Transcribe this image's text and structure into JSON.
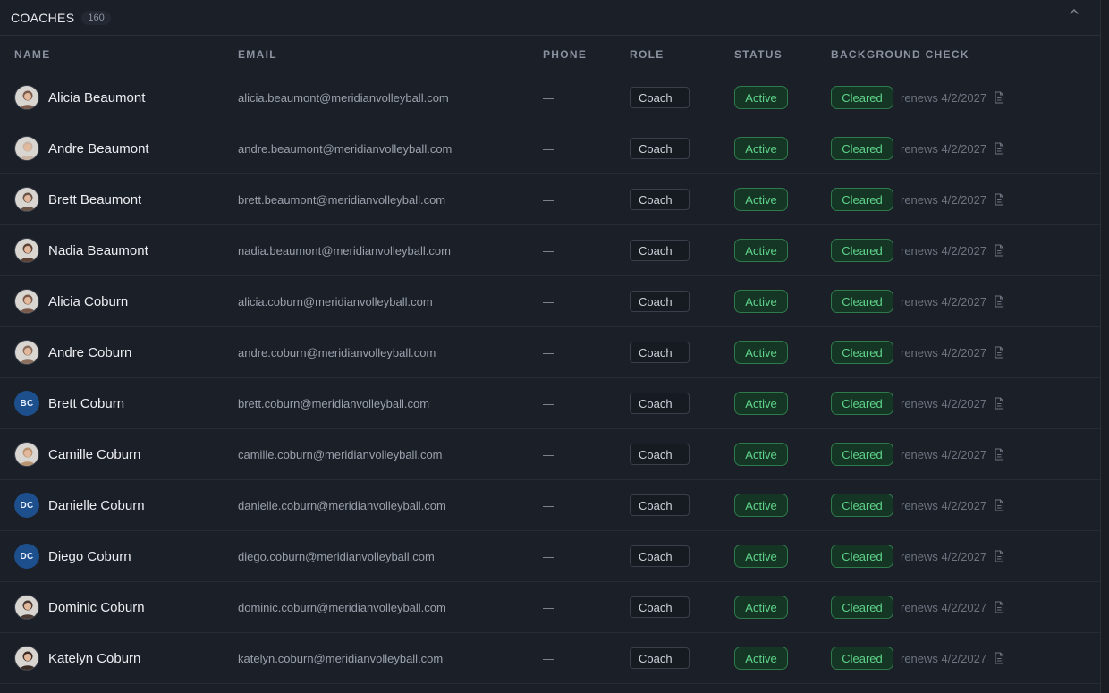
{
  "section": {
    "title": "COACHES",
    "count": "160"
  },
  "columns": {
    "name": "NAME",
    "email": "EMAIL",
    "phone": "PHONE",
    "role": "ROLE",
    "status": "STATUS",
    "background_check": "BACKGROUND CHECK"
  },
  "colors": {
    "background": "#1b1f27",
    "accent_green": "#5ed38a",
    "initials_avatar": "#1d4f8c"
  },
  "rows": [
    {
      "name": "Alicia Beaumont",
      "email": "alicia.beaumont@meridianvolleyball.com",
      "phone": "—",
      "role": "Coach",
      "status": "Active",
      "check": "Cleared",
      "renews": "renews 4/2/2027",
      "avatar": "photo",
      "initials": "",
      "tone": "#7a5a4a"
    },
    {
      "name": "Andre Beaumont",
      "email": "andre.beaumont@meridianvolleyball.com",
      "phone": "—",
      "role": "Coach",
      "status": "Active",
      "check": "Cleared",
      "renews": "renews 4/2/2027",
      "avatar": "photo",
      "initials": "",
      "tone": "#c9b3a2"
    },
    {
      "name": "Brett Beaumont",
      "email": "brett.beaumont@meridianvolleyball.com",
      "phone": "—",
      "role": "Coach",
      "status": "Active",
      "check": "Cleared",
      "renews": "renews 4/2/2027",
      "avatar": "photo",
      "initials": "",
      "tone": "#6a5548"
    },
    {
      "name": "Nadia Beaumont",
      "email": "nadia.beaumont@meridianvolleyball.com",
      "phone": "—",
      "role": "Coach",
      "status": "Active",
      "check": "Cleared",
      "renews": "renews 4/2/2027",
      "avatar": "photo",
      "initials": "",
      "tone": "#5c4034"
    },
    {
      "name": "Alicia Coburn",
      "email": "alicia.coburn@meridianvolleyball.com",
      "phone": "—",
      "role": "Coach",
      "status": "Active",
      "check": "Cleared",
      "renews": "renews 4/2/2027",
      "avatar": "photo",
      "initials": "",
      "tone": "#7a5a4a"
    },
    {
      "name": "Andre Coburn",
      "email": "andre.coburn@meridianvolleyball.com",
      "phone": "—",
      "role": "Coach",
      "status": "Active",
      "check": "Cleared",
      "renews": "renews 4/2/2027",
      "avatar": "photo",
      "initials": "",
      "tone": "#8a6f5e"
    },
    {
      "name": "Brett Coburn",
      "email": "brett.coburn@meridianvolleyball.com",
      "phone": "—",
      "role": "Coach",
      "status": "Active",
      "check": "Cleared",
      "renews": "renews 4/2/2027",
      "avatar": "initials",
      "initials": "BC",
      "tone": ""
    },
    {
      "name": "Camille Coburn",
      "email": "camille.coburn@meridianvolleyball.com",
      "phone": "—",
      "role": "Coach",
      "status": "Active",
      "check": "Cleared",
      "renews": "renews 4/2/2027",
      "avatar": "photo",
      "initials": "",
      "tone": "#b89470"
    },
    {
      "name": "Danielle Coburn",
      "email": "danielle.coburn@meridianvolleyball.com",
      "phone": "—",
      "role": "Coach",
      "status": "Active",
      "check": "Cleared",
      "renews": "renews 4/2/2027",
      "avatar": "initials",
      "initials": "DC",
      "tone": ""
    },
    {
      "name": "Diego Coburn",
      "email": "diego.coburn@meridianvolleyball.com",
      "phone": "—",
      "role": "Coach",
      "status": "Active",
      "check": "Cleared",
      "renews": "renews 4/2/2027",
      "avatar": "initials",
      "initials": "DC",
      "tone": ""
    },
    {
      "name": "Dominic Coburn",
      "email": "dominic.coburn@meridianvolleyball.com",
      "phone": "—",
      "role": "Coach",
      "status": "Active",
      "check": "Cleared",
      "renews": "renews 4/2/2027",
      "avatar": "photo",
      "initials": "",
      "tone": "#4a3a32"
    },
    {
      "name": "Katelyn Coburn",
      "email": "katelyn.coburn@meridianvolleyball.com",
      "phone": "—",
      "role": "Coach",
      "status": "Active",
      "check": "Cleared",
      "renews": "renews 4/2/2027",
      "avatar": "photo",
      "initials": "",
      "tone": "#3e2c26"
    }
  ]
}
